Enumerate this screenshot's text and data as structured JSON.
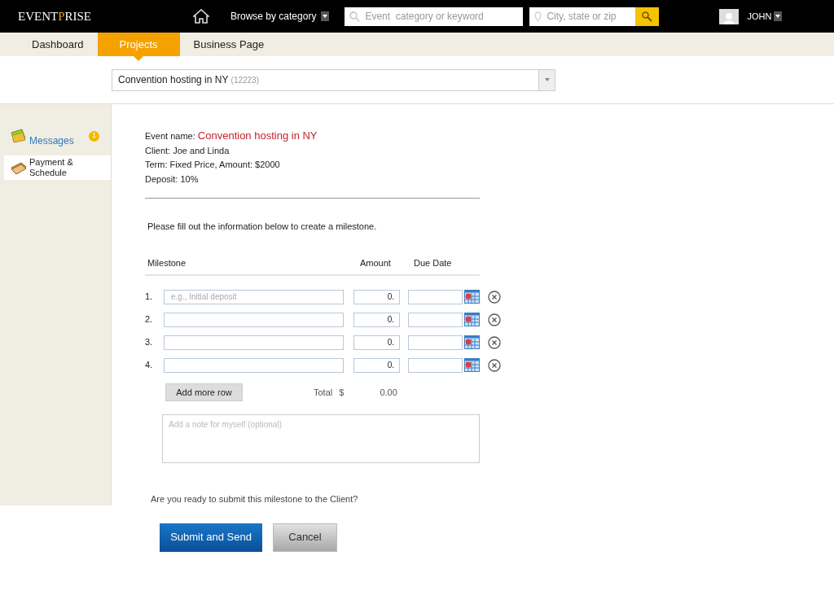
{
  "logo": {
    "before": "EVENT",
    "accent": "P",
    "after": "RISE"
  },
  "header": {
    "browse": "Browse by category",
    "search_placeholder": "Event  category or keyword",
    "location_placeholder": "City, state or zip",
    "user": "JOHN"
  },
  "tabs": [
    {
      "label": "Dashboard",
      "selected": false
    },
    {
      "label": "Projects",
      "selected": true
    },
    {
      "label": "Business Page",
      "selected": false
    }
  ],
  "project_select": {
    "value": "Convention hosting in NY",
    "code": "(12223)"
  },
  "sidebar": {
    "items": [
      {
        "kind": "messages",
        "label": "Messages",
        "badge": "1",
        "selected": false
      },
      {
        "kind": "payment",
        "label": "Payment & Schedule",
        "selected": true
      }
    ]
  },
  "event": {
    "name_label": "Event name:",
    "name": "Convention hosting in NY",
    "client": "Client: Joe and Linda",
    "term": "Term: Fixed Price, Amount:  $2000",
    "deposit": "Deposit: 10%"
  },
  "instruction": "Please fill out the information below to create a milestone.",
  "table": {
    "columns": [
      "Milestone",
      "Amount",
      "Due Date"
    ],
    "rows": [
      {
        "number": "1.",
        "placeholder": "e.g., Initial deposit",
        "amount": "0."
      },
      {
        "number": "2.",
        "amount": "0."
      },
      {
        "number": "3.",
        "amount": "0."
      },
      {
        "number": "4.",
        "amount": "0."
      }
    ]
  },
  "add_row": "Add more row",
  "total_label": "Total",
  "currency": "$",
  "total": "0.00",
  "note_placeholder": "Add a note for myself (optional)",
  "question": "Are you ready to submit this milestone to the Client?",
  "buttons": {
    "submit": "Submit and Send",
    "cancel": "Cancel"
  }
}
